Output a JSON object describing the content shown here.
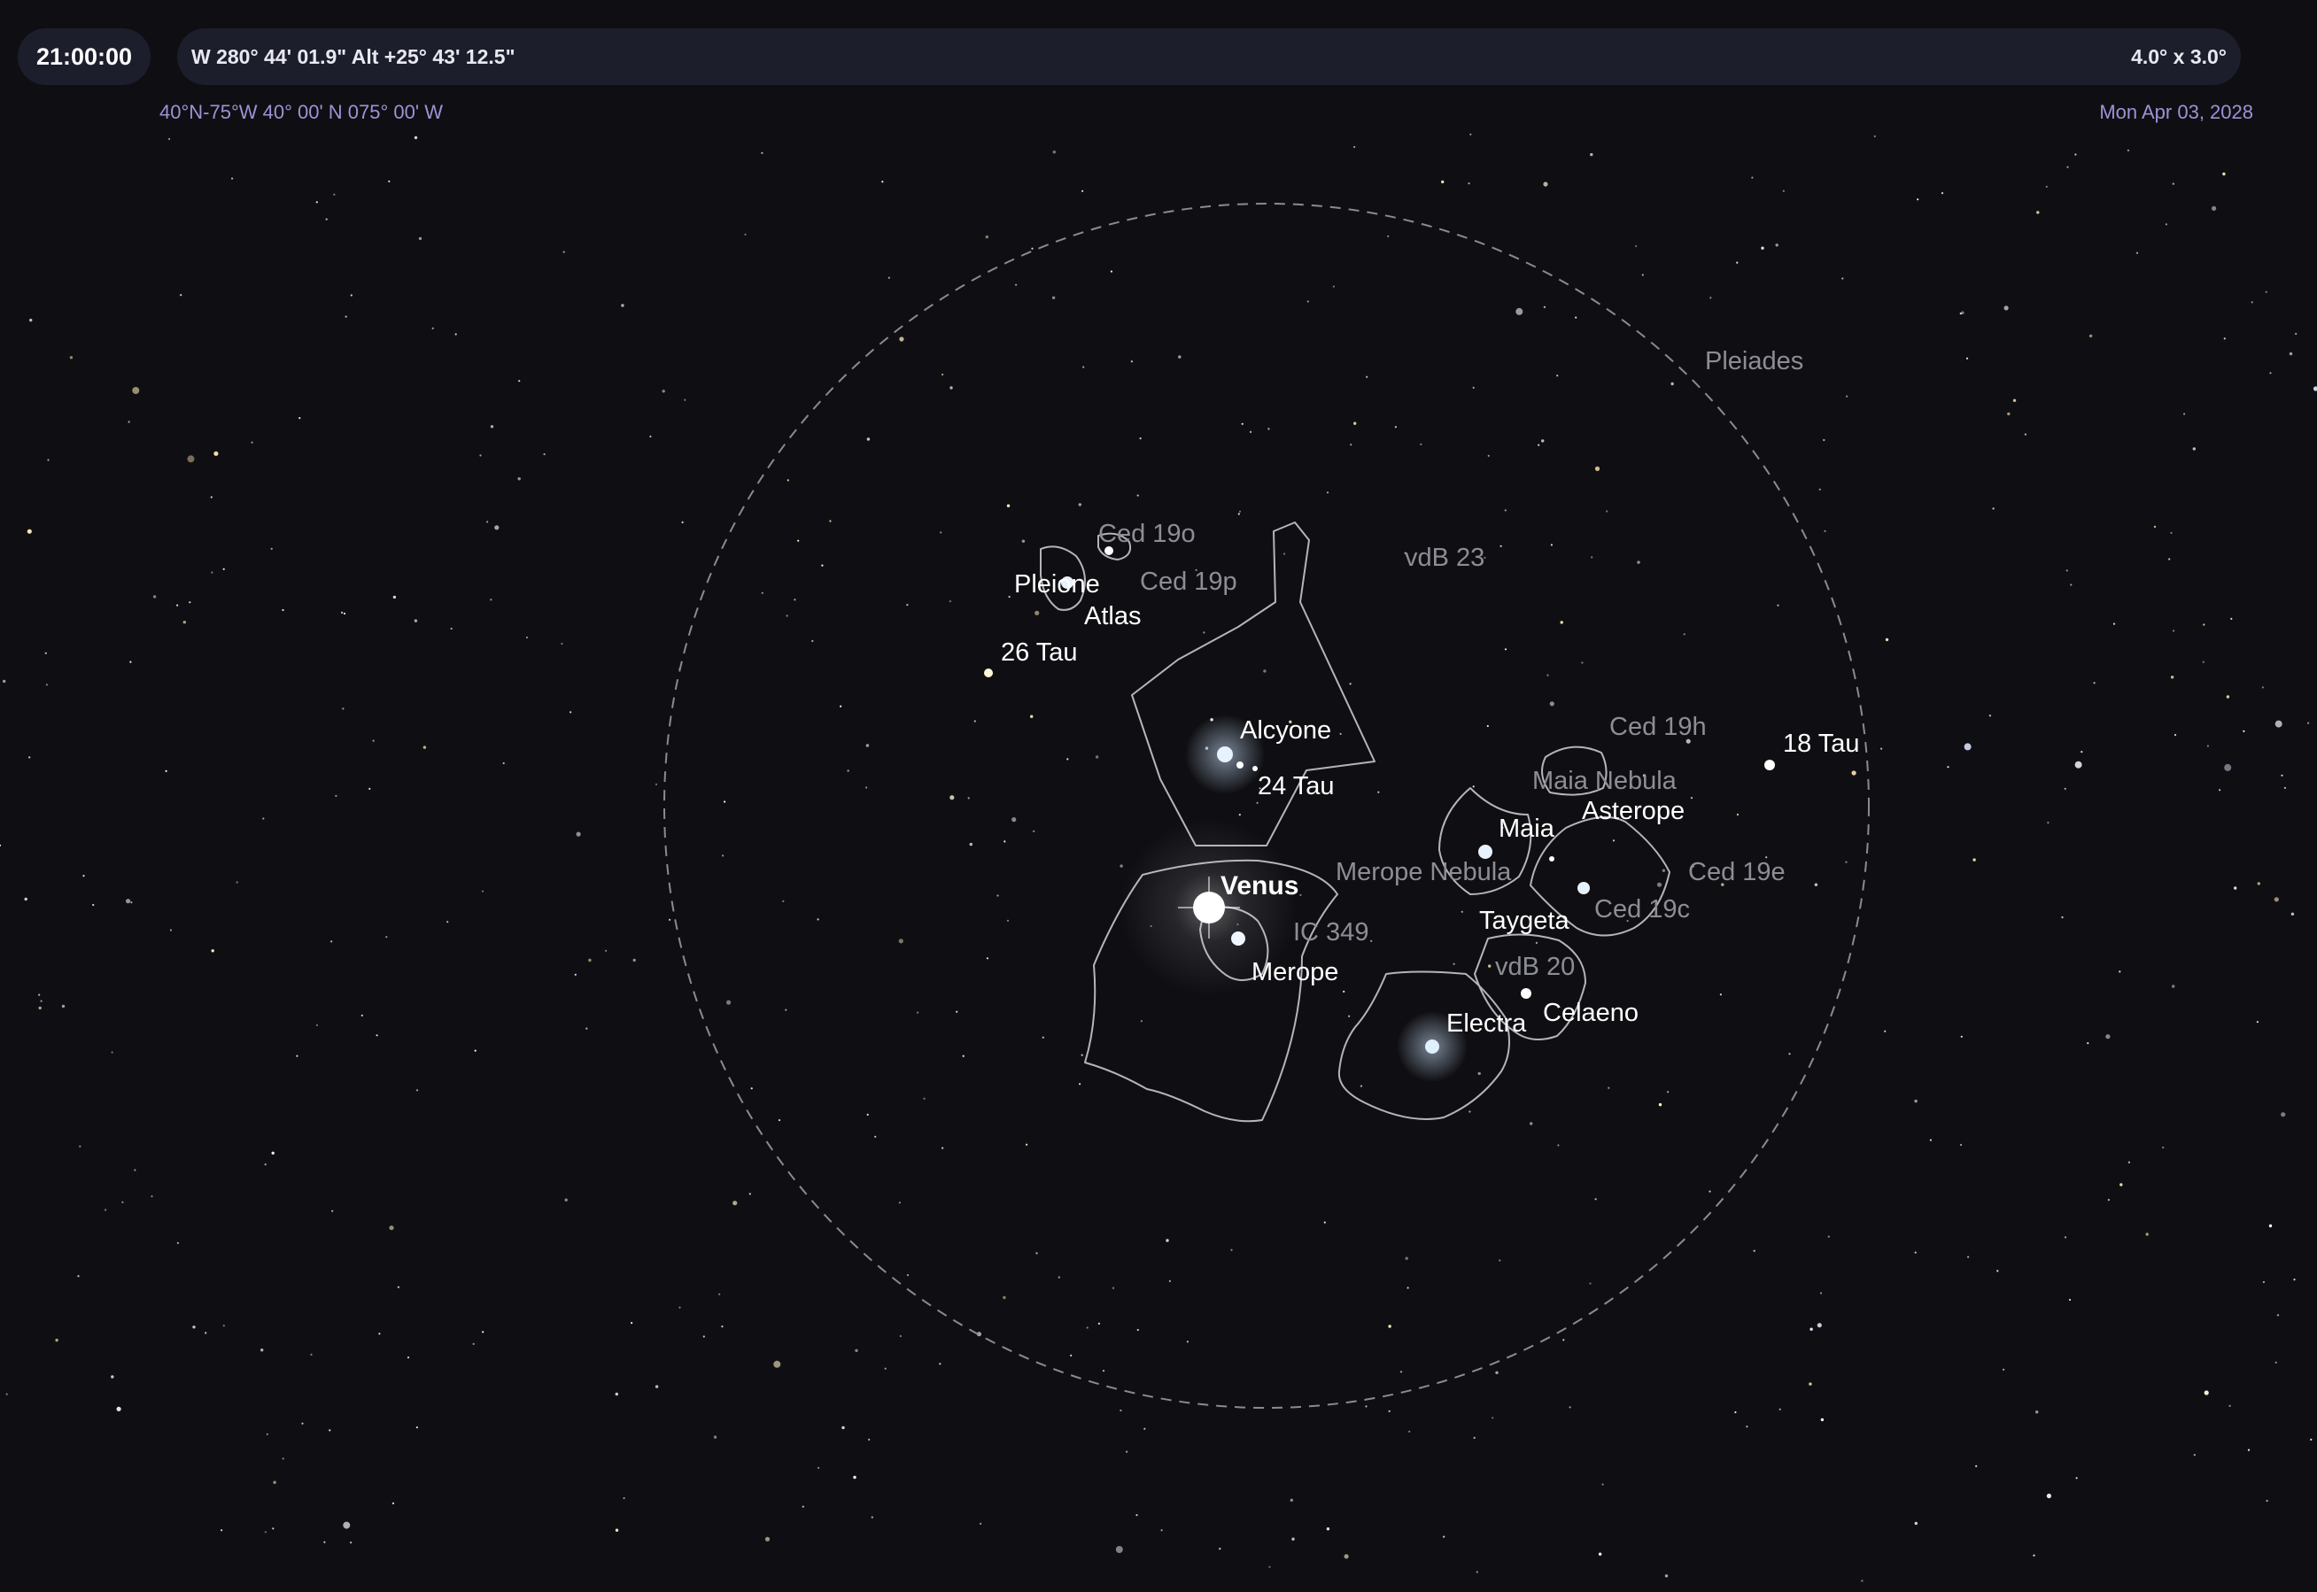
{
  "status_bar": {
    "time": "21:00:00",
    "coordinates": "W 280° 44' 01.9\" Alt +25° 43' 12.5\"",
    "field_of_view": "4.0° x 3.0°",
    "location": "40°N-75°W  40° 00' N 075° 00' W",
    "date": "Mon Apr 03, 2028"
  },
  "sky": {
    "cluster_label": "Pleiades",
    "stars": [
      "Pleione",
      "Atlas",
      "26 Tau",
      "Alcyone",
      "24 Tau",
      "Maia",
      "Asterope",
      "18 Tau",
      "Taygeta",
      "Merope",
      "Electra",
      "Celaeno"
    ],
    "planets": [
      "Venus"
    ],
    "deep_sky_objects": [
      "Ced 19o",
      "Ced 19p",
      "vdB 23",
      "Ced 19h",
      "Maia Nebula",
      "Merope Nebula",
      "Ced 19e",
      "Ced 19c",
      "IC 349",
      "vdB 20"
    ]
  },
  "colors": {
    "background": "#0f0f13",
    "bar": "#1c1e2c",
    "location_text": "#9c93d6",
    "star_label": "#ffffff",
    "dso_label": "#8d8d96",
    "nebula_outline": "#b4b4bc"
  }
}
